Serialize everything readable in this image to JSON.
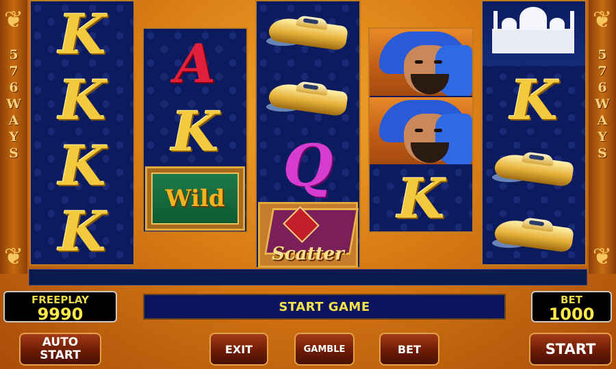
{
  "side": {
    "text": [
      "5",
      "7",
      "6",
      "W",
      "A",
      "Y",
      "S"
    ]
  },
  "reels": {
    "r2_top": "A",
    "wild_label": "Wild",
    "scatter_label": "Scatter",
    "k": "K",
    "q": "Q"
  },
  "freeplay": {
    "label": "FREEPLAY",
    "value": "9990"
  },
  "bet_panel": {
    "label": "BET",
    "value": "1000"
  },
  "message": "START GAME",
  "buttons": {
    "auto_start": [
      "AUTO",
      "START"
    ],
    "exit": "EXIT",
    "gamble": "GAMBLE",
    "bet": "BET",
    "start": "START"
  },
  "colors": {
    "accent": "#f3c93e",
    "reel_bg": "#0c1a5e",
    "button_border": "#e3a24a"
  }
}
